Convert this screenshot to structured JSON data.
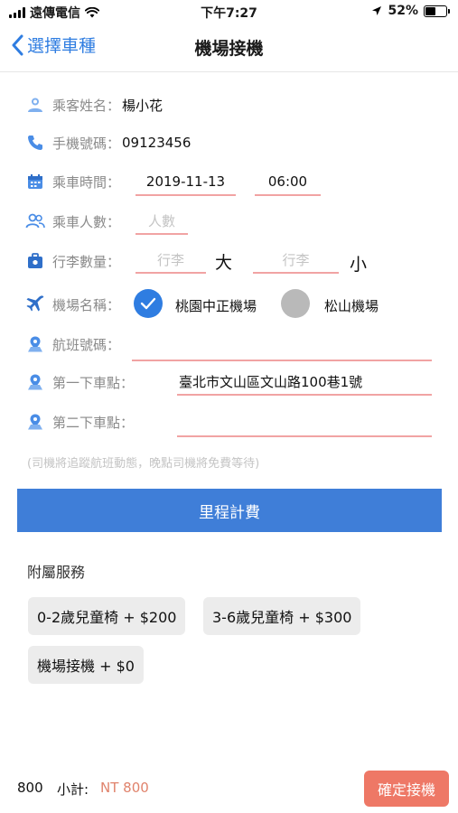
{
  "status_bar": {
    "carrier": "遠傳電信",
    "time": "下午7:27",
    "battery": "52%",
    "battery_level": 0.52
  },
  "nav": {
    "back_label": "選擇車種",
    "title": "機場接機"
  },
  "form": {
    "passenger_name": {
      "label": "乘客姓名：",
      "value": "楊小花"
    },
    "phone": {
      "label": "手機號碼：",
      "value": "09123456"
    },
    "ride_time": {
      "label": "乘車時間：",
      "date": "2019-11-13",
      "time": "06:00"
    },
    "passengers": {
      "label": "乘車人數：",
      "placeholder": "人數"
    },
    "luggage": {
      "label": "行李數量：",
      "large_placeholder": "行李",
      "large_unit": "大",
      "small_placeholder": "行李",
      "small_unit": "小"
    },
    "airport": {
      "label": "機場名稱：",
      "options": [
        "桃園中正機場",
        "松山機場"
      ],
      "selected": "桃園中正機場"
    },
    "flight": {
      "label": "航班號碼：",
      "value": ""
    },
    "dropoff1": {
      "label": "第一下車點：",
      "value": "臺北市文山區文山路100巷1號"
    },
    "dropoff2": {
      "label": "第二下車點：",
      "value": ""
    }
  },
  "note": "(司機將追蹤航班動態，晚點司機將免費等待)",
  "mileage_button": "里程計費",
  "addon": {
    "title": "附屬服務",
    "items": [
      "0-2歲兒童椅 + $200",
      "3-6歲兒童椅 + $300",
      "機場接機 + $0"
    ]
  },
  "footer": {
    "count": "800",
    "subtotal_label": "小計:",
    "subtotal_value": "NT 800",
    "confirm": "確定接機"
  },
  "colors": {
    "accent": "#2f7de1",
    "button_blue": "#3f7ed8",
    "confirm": "#ee7866",
    "underline": "#f1a3a3"
  }
}
